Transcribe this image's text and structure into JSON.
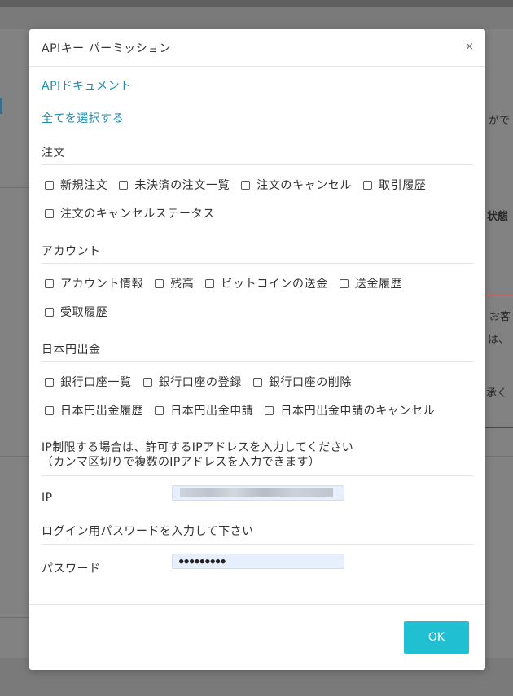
{
  "background": {
    "fragments": [
      "がで",
      "状態",
      "お客",
      "は、",
      "承く"
    ]
  },
  "modal": {
    "title": "APIキー パーミッション",
    "close_label": "×",
    "doc_link": "APIドキュメント",
    "select_all_link": "全てを選択する",
    "sections": [
      {
        "title": "注文",
        "rows": [
          [
            "新規注文",
            "未決済の注文一覧",
            "注文のキャンセル",
            "取引履歴"
          ],
          [
            "注文のキャンセルステータス"
          ]
        ]
      },
      {
        "title": "アカウント",
        "rows": [
          [
            "アカウント情報",
            "残高",
            "ビットコインの送金",
            "送金履歴"
          ],
          [
            "受取履歴"
          ]
        ]
      },
      {
        "title": "日本円出金",
        "rows": [
          [
            "銀行口座一覧",
            "銀行口座の登録",
            "銀行口座の削除"
          ],
          [
            "日本円出金履歴",
            "日本円出金申請",
            "日本円出金申請のキャンセル"
          ]
        ]
      }
    ],
    "ip_note_line1": "IP制限する場合は、許可するIPアドレスを入力してください",
    "ip_note_line2": "（カンマ区切りで複数のIPアドレスを入力できます）",
    "ip_label": "IP",
    "password_instruction": "ログイン用パスワードを入力して下さい",
    "password_label": "パスワード",
    "password_value": "●●●●●●●●●",
    "ok_label": "OK"
  },
  "colors": {
    "link": "#1f8bb3",
    "ok_button": "#20bfd1",
    "input_bg": "#e8effc"
  }
}
